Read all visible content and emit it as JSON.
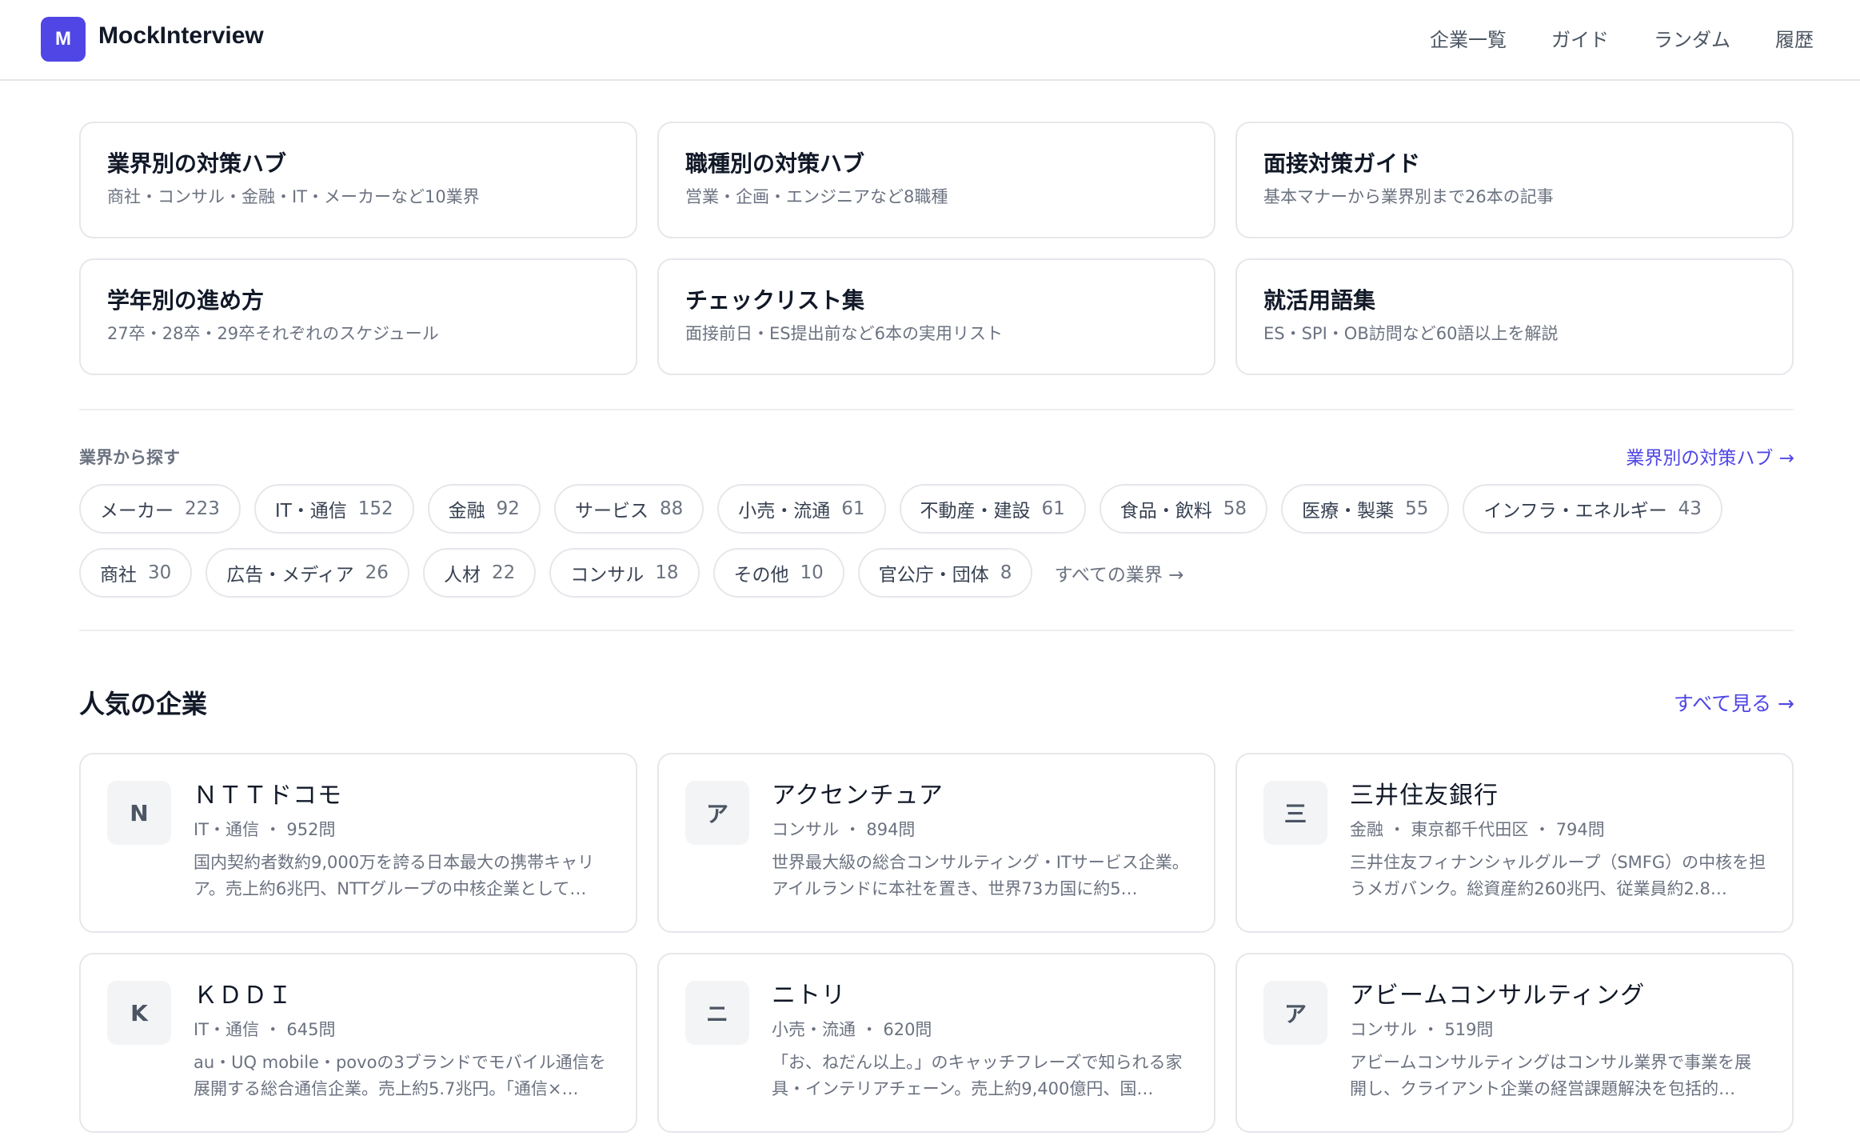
{
  "app": {
    "logo_letter": "M",
    "name": "MockInterview"
  },
  "nav": [
    {
      "label": "企業一覧"
    },
    {
      "label": "ガイド"
    },
    {
      "label": "ランダム"
    },
    {
      "label": "履歴"
    }
  ],
  "hubs": [
    {
      "title": "業界別の対策ハブ",
      "subtitle": "商社・コンサル・金融・IT・メーカーなど10業界"
    },
    {
      "title": "職種別の対策ハブ",
      "subtitle": "営業・企画・エンジニアなど8職種"
    },
    {
      "title": "面接対策ガイド",
      "subtitle": "基本マナーから業界別まで26本の記事"
    },
    {
      "title": "学年別の進め方",
      "subtitle": "27卒・28卒・29卒それぞれのスケジュール"
    },
    {
      "title": "チェックリスト集",
      "subtitle": "面接前日・ES提出前など6本の実用リスト"
    },
    {
      "title": "就活用語集",
      "subtitle": "ES・SPI・OB訪問など60語以上を解説"
    }
  ],
  "industry": {
    "label": "業界から探す",
    "hub_link": "業界別の対策ハブ →",
    "chips": [
      {
        "name": "メーカー",
        "count": "223"
      },
      {
        "name": "IT・通信",
        "count": "152"
      },
      {
        "name": "金融",
        "count": "92"
      },
      {
        "name": "サービス",
        "count": "88"
      },
      {
        "name": "小売・流通",
        "count": "61"
      },
      {
        "name": "不動産・建設",
        "count": "61"
      },
      {
        "name": "食品・飲料",
        "count": "58"
      },
      {
        "name": "医療・製薬",
        "count": "55"
      },
      {
        "name": "インフラ・エネルギー",
        "count": "43"
      },
      {
        "name": "商社",
        "count": "30"
      },
      {
        "name": "広告・メディア",
        "count": "26"
      },
      {
        "name": "人材",
        "count": "22"
      },
      {
        "name": "コンサル",
        "count": "18"
      },
      {
        "name": "その他",
        "count": "10"
      },
      {
        "name": "官公庁・団体",
        "count": "8"
      }
    ],
    "all_link": "すべての業界 →"
  },
  "popular": {
    "title": "人気の企業",
    "see_all": "すべて見る →",
    "companies": [
      {
        "initial": "N",
        "name": "ＮＴＴドコモ",
        "meta": "IT・通信 ・ 952問",
        "desc": "国内契約者数約9,000万を誇る日本最大の携帯キャリア。売上約6兆円、NTTグループの中核企業として…"
      },
      {
        "initial": "ア",
        "name": "アクセンチュア",
        "meta": "コンサル ・ 894問",
        "desc": "世界最大級の総合コンサルティング・ITサービス企業。アイルランドに本社を置き、世界73カ国に約5…"
      },
      {
        "initial": "三",
        "name": "三井住友銀行",
        "meta": "金融 ・ 東京都千代田区 ・ 794問",
        "desc": "三井住友フィナンシャルグループ（SMFG）の中核を担うメガバンク。総資産約260兆円、従業員約2.8…"
      },
      {
        "initial": "K",
        "name": "ＫＤＤＩ",
        "meta": "IT・通信 ・ 645問",
        "desc": "au・UQ mobile・povoの3ブランドでモバイル通信を展開する総合通信企業。売上約5.7兆円。「通信×…"
      },
      {
        "initial": "ニ",
        "name": "ニトリ",
        "meta": "小売・流通 ・ 620問",
        "desc": "「お、ねだん以上。」のキャッチフレーズで知られる家具・インテリアチェーン。売上約9,400億円、国…"
      },
      {
        "initial": "ア",
        "name": "アビームコンサルティング",
        "meta": "コンサル ・ 519問",
        "desc": "アビームコンサルティングはコンサル業界で事業を展開し、クライアント企業の経営課題解決を包括的…"
      }
    ]
  }
}
